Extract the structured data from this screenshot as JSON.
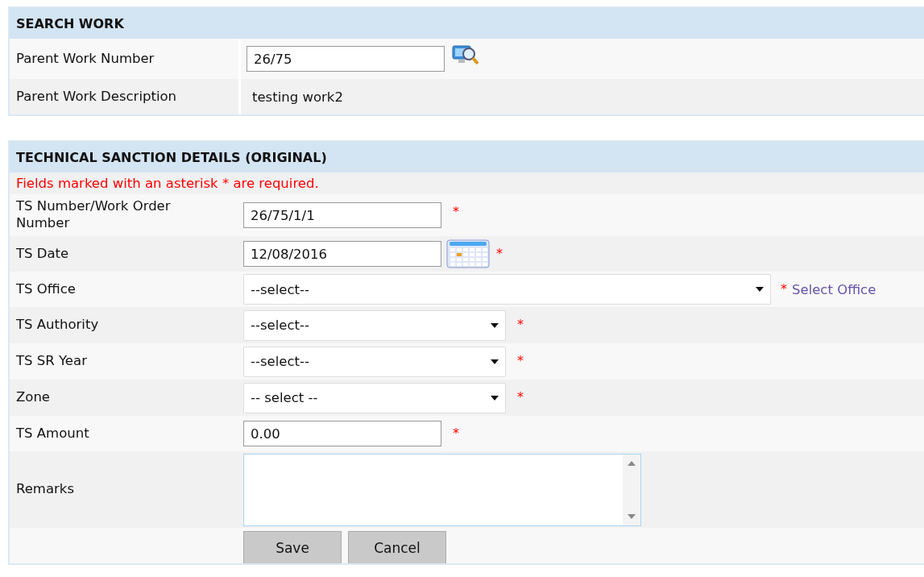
{
  "search_work": {
    "title": "SEARCH WORK",
    "rows": [
      {
        "kind": "search",
        "label": "Parent Work Number",
        "value": "26/75"
      },
      {
        "kind": "static",
        "label": "Parent Work Description",
        "value": "testing work2"
      }
    ]
  },
  "technical_sanction": {
    "title": "TECHNICAL SANCTION DETAILS (ORIGINAL)",
    "notice": "Fields marked with an asterisk * are required.",
    "rows": [
      {
        "kind": "text",
        "label": "TS Number/Work Order Number",
        "value": "26/75/1/1",
        "required_mark": "*"
      },
      {
        "kind": "date",
        "label": "TS Date",
        "value": "12/08/2016",
        "required_mark": "*"
      },
      {
        "kind": "wide_select",
        "label": "TS Office",
        "value": "--select--",
        "required_mark": "*",
        "link": "Select Office"
      },
      {
        "kind": "select",
        "label": "TS Authority",
        "value": "--select--",
        "required_mark": "*"
      },
      {
        "kind": "select",
        "label": "TS SR Year",
        "value": "--select--",
        "required_mark": "*"
      },
      {
        "kind": "select",
        "label": "Zone",
        "value": "-- select --",
        "required_mark": "*"
      },
      {
        "kind": "text",
        "label": "TS Amount",
        "value": "0.00",
        "required_mark": "*"
      },
      {
        "kind": "textarea",
        "label": "Remarks"
      }
    ],
    "buttons": [
      "Save",
      "Cancel"
    ]
  }
}
